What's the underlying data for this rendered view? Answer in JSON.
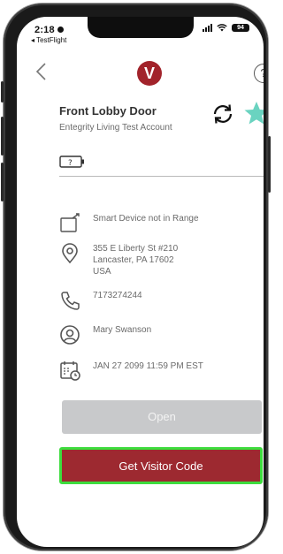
{
  "status_bar": {
    "time": "2:18",
    "back_app": "◂ TestFlight",
    "battery": "94"
  },
  "header": {
    "logo_letter": "V",
    "help_label": "?",
    "icons": [
      "back-chevron-icon",
      "vivint-logo",
      "help-icon"
    ]
  },
  "door": {
    "title": "Front Lobby Door",
    "account": "Entegrity Living Test Account",
    "favorite": true,
    "accent_color": "#6ad3c0"
  },
  "details": [
    {
      "icon": "smart-device-icon",
      "text": "Smart Device not in Range"
    },
    {
      "icon": "location-pin-icon",
      "lines": [
        "355 E Liberty St #210",
        "Lancaster, PA 17602",
        "USA"
      ]
    },
    {
      "icon": "phone-icon",
      "text": "7173274244"
    },
    {
      "icon": "user-icon",
      "text": "Mary Swanson"
    },
    {
      "icon": "calendar-clock-icon",
      "text": "JAN 27 2099 11:59 PM EST"
    }
  ],
  "actions": {
    "open_label": "Open",
    "visitor_code_label": "Get Visitor Code"
  },
  "colors": {
    "brand": "#a2232b",
    "visitor_button": "#9d2930",
    "highlight": "#3ddc3d",
    "disabled_button": "#c8c9cb"
  }
}
